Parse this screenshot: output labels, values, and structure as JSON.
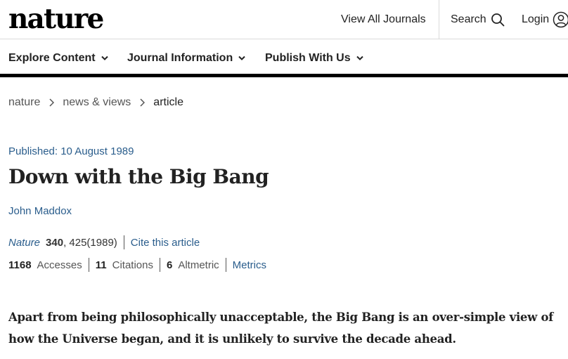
{
  "header": {
    "logo": "nature",
    "view_all_journals": "View All Journals",
    "search_label": "Search",
    "login_label": "Login"
  },
  "nav": {
    "items": [
      {
        "label": "Explore Content"
      },
      {
        "label": "Journal Information"
      },
      {
        "label": "Publish With Us"
      }
    ]
  },
  "breadcrumb": {
    "items": [
      "nature",
      "news & views",
      "article"
    ]
  },
  "article": {
    "published": "Published: 10 August 1989",
    "title": "Down with the Big Bang",
    "author": "John Maddox",
    "journal": "Nature",
    "volume": "340",
    "pages_year": ", 425(1989)",
    "cite_link": "Cite this article",
    "accesses_value": "1168",
    "accesses_label": "Accesses",
    "citations_value": "11",
    "citations_label": "Citations",
    "altmetric_value": "6",
    "altmetric_label": "Altmetric",
    "metrics_link": "Metrics",
    "lead": "Apart from being philosophically unacceptable, the Big Bang is an over-simple view of how the Universe began, and it is unlikely to survive the decade ahead."
  },
  "colors": {
    "link_blue": "#2a5d8c",
    "text": "#222222",
    "nav_rule": "#000000"
  }
}
